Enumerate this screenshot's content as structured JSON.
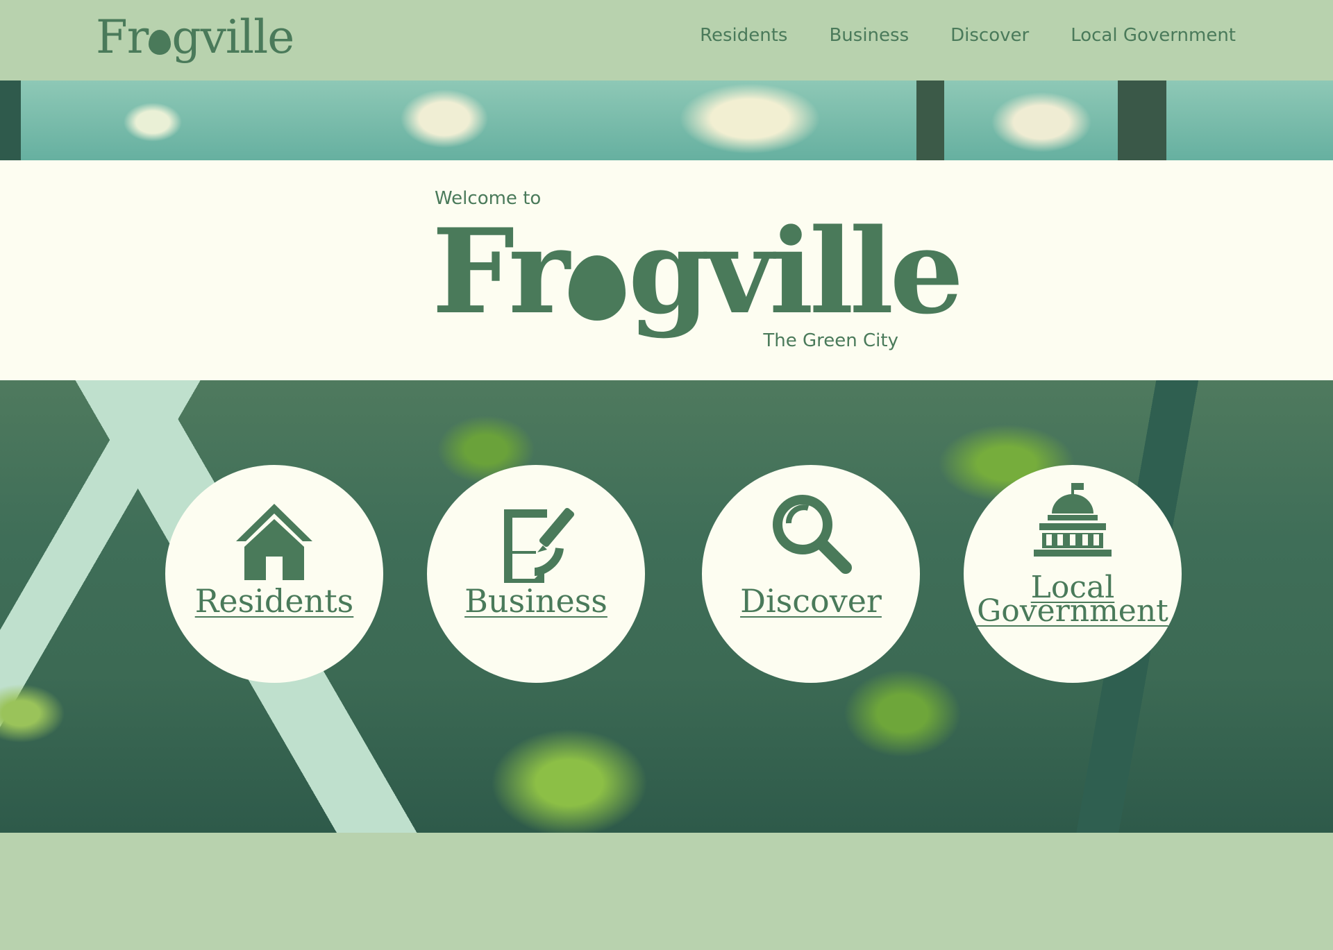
{
  "header": {
    "logo": {
      "prefix": "Fr",
      "suffix": "gville"
    },
    "nav": [
      "Residents",
      "Business",
      "Discover",
      "Local Government"
    ]
  },
  "banner": {
    "welcome": "Welcome to",
    "title": {
      "prefix": "Fr",
      "suffix": "gville"
    },
    "tagline": "The Green City"
  },
  "cards": [
    {
      "label": "Residents",
      "icon": "house-icon"
    },
    {
      "label": "Business",
      "icon": "document-pen-icon"
    },
    {
      "label": "Discover",
      "icon": "magnifier-icon"
    },
    {
      "label_line1": "Local",
      "label_line2": "Government",
      "icon": "capitol-building-icon"
    }
  ],
  "colors": {
    "brand_green": "#4a7a5a",
    "header_bg": "#b8d2ae",
    "cream": "#fdfdf1"
  }
}
